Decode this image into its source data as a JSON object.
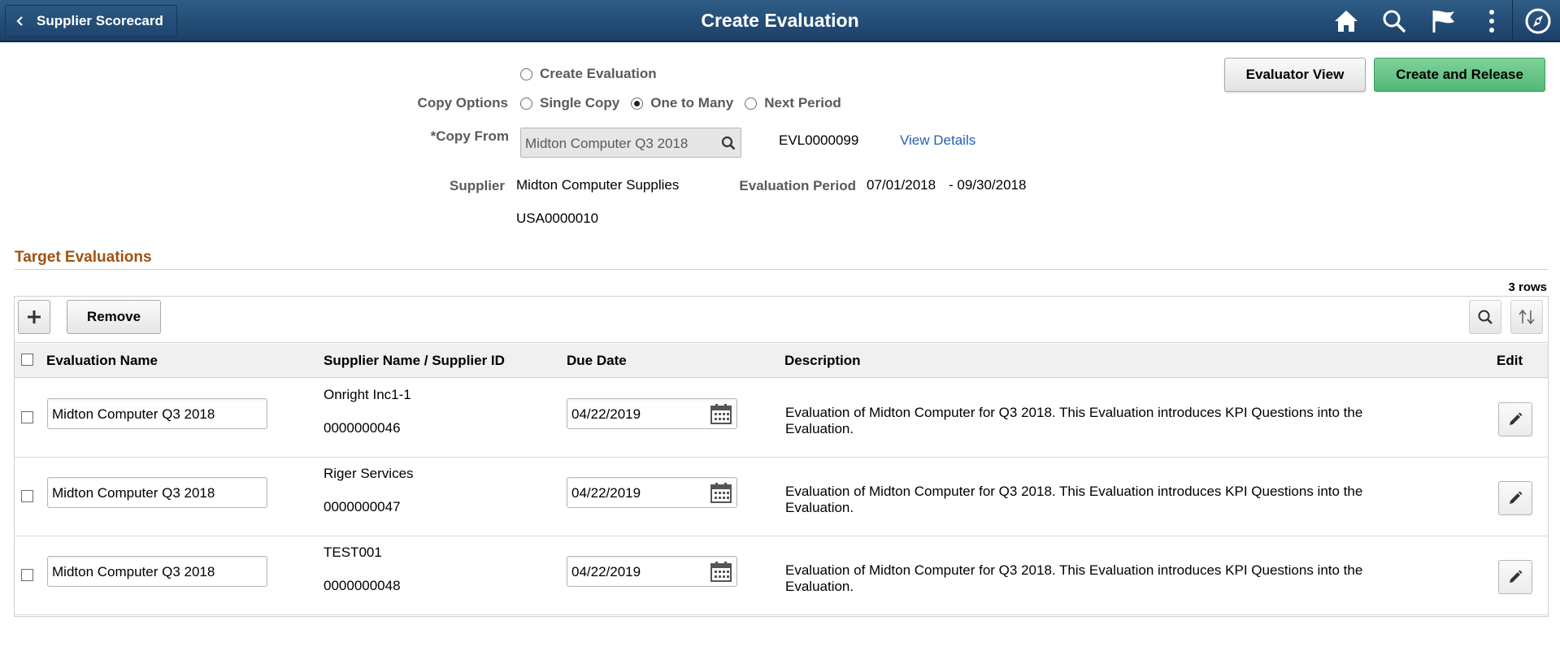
{
  "header": {
    "back_label": "Supplier Scorecard",
    "title": "Create Evaluation",
    "icons": [
      "home-icon",
      "search-icon",
      "flag-icon",
      "more-options-icon",
      "navigator-icon"
    ]
  },
  "buttons": {
    "evaluator_view": "Evaluator View",
    "create_release": "Create and Release"
  },
  "copy_options": {
    "label": "Copy Options",
    "create_evaluation": "Create Evaluation",
    "single_copy": "Single Copy",
    "one_to_many": "One to Many",
    "next_period": "Next Period",
    "selected": "One to Many"
  },
  "copy_from": {
    "label": "*Copy From",
    "value": "Midton Computer Q3 2018",
    "evaluation_id": "EVL0000099",
    "view_details": "View Details"
  },
  "supplier": {
    "label": "Supplier",
    "name": "Midton Computer Supplies",
    "id": "USA0000010"
  },
  "evaluation_period": {
    "label": "Evaluation Period",
    "start": "07/01/2018",
    "end": "- 09/30/2018"
  },
  "target": {
    "title": "Target Evaluations",
    "row_count": "3 rows",
    "remove_label": "Remove",
    "columns": {
      "name": "Evaluation Name",
      "supplier": "Supplier Name / Supplier ID",
      "due": "Due Date",
      "description": "Description",
      "edit": "Edit"
    },
    "rows": [
      {
        "name": "Midton Computer Q3 2018",
        "supplier_name": "Onright Inc1-1",
        "supplier_id": "0000000046",
        "due_date": "04/22/2019",
        "description": "Evaluation of Midton Computer for Q3 2018.  This Evaluation introduces KPI Questions into the Evaluation."
      },
      {
        "name": "Midton Computer Q3 2018",
        "supplier_name": "Riger Services",
        "supplier_id": "0000000047",
        "due_date": "04/22/2019",
        "description": "Evaluation of Midton Computer for Q3 2018.  This Evaluation introduces KPI Questions into the Evaluation."
      },
      {
        "name": "Midton Computer Q3 2018",
        "supplier_name": "TEST001",
        "supplier_id": "0000000048",
        "due_date": "04/22/2019",
        "description": "Evaluation of Midton Computer for Q3 2018.  This Evaluation introduces KPI Questions into the Evaluation."
      }
    ]
  }
}
